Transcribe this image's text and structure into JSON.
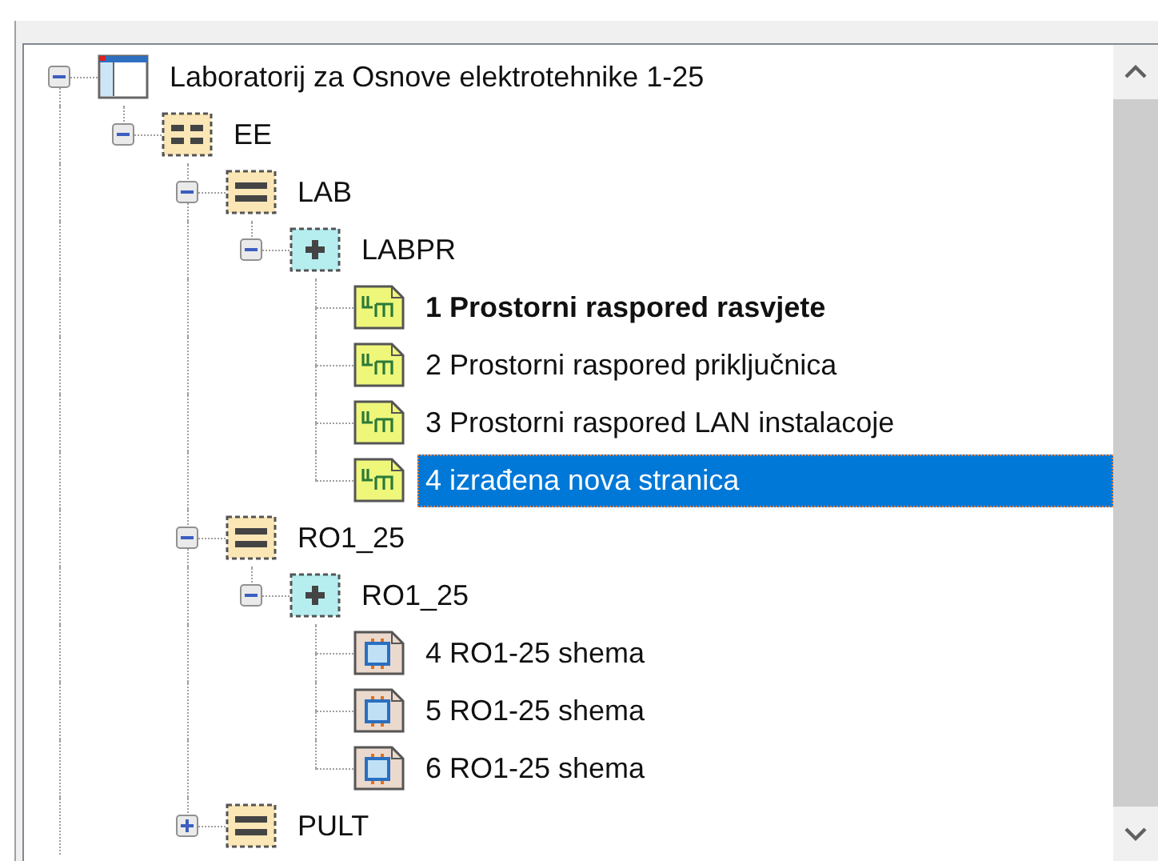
{
  "tree": {
    "label": "Laboratorij za Osnove elektrotehnike 1-25",
    "kind": "project",
    "expanded": true,
    "selected": false,
    "bold": false,
    "children": [
      {
        "label": "EE",
        "kind": "grid-folder",
        "expanded": true,
        "selected": false,
        "bold": false,
        "children": [
          {
            "label": "LAB",
            "kind": "folder",
            "expanded": true,
            "selected": false,
            "bold": false,
            "children": [
              {
                "label": "LABPR",
                "kind": "group",
                "expanded": true,
                "selected": false,
                "bold": false,
                "children": [
                  {
                    "label": "1 Prostorni raspored rasvjete",
                    "kind": "page",
                    "selected": false,
                    "bold": true
                  },
                  {
                    "label": "2 Prostorni raspored priključnica",
                    "kind": "page",
                    "selected": false,
                    "bold": false
                  },
                  {
                    "label": "3 Prostorni raspored LAN instalacoje",
                    "kind": "page",
                    "selected": false,
                    "bold": false
                  },
                  {
                    "label": "4 izrađena nova stranica",
                    "kind": "page",
                    "selected": true,
                    "bold": false
                  }
                ]
              }
            ]
          },
          {
            "label": "RO1_25",
            "kind": "folder",
            "expanded": true,
            "selected": false,
            "bold": false,
            "children": [
              {
                "label": "RO1_25",
                "kind": "group",
                "expanded": true,
                "selected": false,
                "bold": false,
                "children": [
                  {
                    "label": "4 RO1-25 shema",
                    "kind": "schematic",
                    "selected": false,
                    "bold": false
                  },
                  {
                    "label": "5 RO1-25 shema",
                    "kind": "schematic",
                    "selected": false,
                    "bold": false
                  },
                  {
                    "label": "6 RO1-25 shema",
                    "kind": "schematic",
                    "selected": false,
                    "bold": false
                  }
                ]
              }
            ]
          },
          {
            "label": "PULT",
            "kind": "folder",
            "expanded": false,
            "selected": false,
            "bold": false
          }
        ]
      }
    ]
  }
}
